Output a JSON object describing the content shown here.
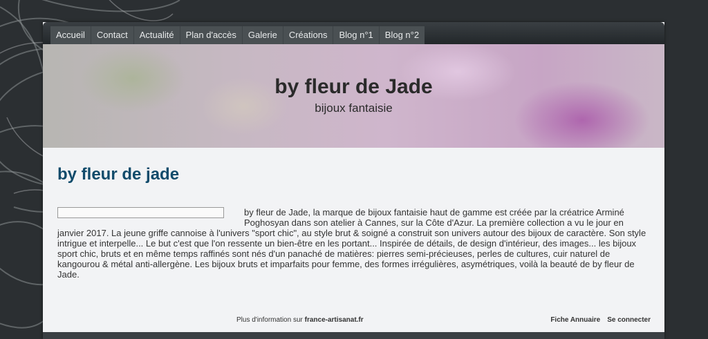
{
  "nav": {
    "items": [
      "Accueil",
      "Contact",
      "Actualité",
      "Plan d'accès",
      "Galerie",
      "Créations",
      "Blog n°1",
      "Blog n°2"
    ]
  },
  "banner": {
    "title": "by fleur de Jade",
    "subtitle": "bijoux fantaisie"
  },
  "content": {
    "title": "by fleur de jade",
    "paragraph": "by fleur de Jade, la marque de bijoux fantaisie haut de gamme est créée par la créatrice Arminé Poghosyan dans son atelier à Cannes, sur la Côte d'Azur. La première collection a vu le jour en janvier 2017.  La jeune griffe cannoise à l'univers \"sport chic\", au style brut & soigné a construit son univers autour des bijoux de caractère. Son style intrigue et interpelle... Le but c'est que l'on ressente un bien-être en les portant... Inspirée de détails, de design d'intérieur, des images... les bijoux sport chic, bruts et en même temps raffinés sont nés d'un panaché de matières: pierres semi-précieuses, perles de cultures, cuir naturel de kangourou & métal anti-allergène. Les bijoux bruts et imparfaits pour femme, des formes irrégulières, asymétriques, voilà la beauté de by fleur de Jade."
  },
  "footer": {
    "info_prefix": "Plus d'information sur",
    "info_link": "france-artisanat.fr",
    "links": [
      "Fiche Annuaire",
      "Se connecter"
    ]
  },
  "colors": {
    "title": "#114b6b",
    "background": "#2b2f32",
    "page": "#f2f3f5"
  }
}
